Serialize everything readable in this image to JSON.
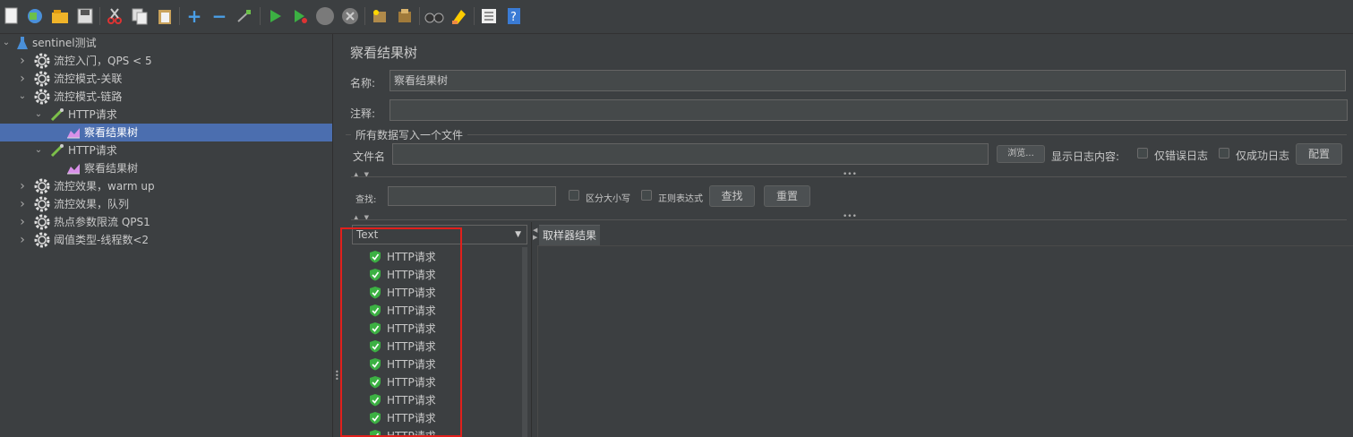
{
  "toolbar": {
    "icons": [
      "new-icon",
      "templates-icon",
      "open-icon",
      "save-icon",
      "cut-icon",
      "copy-icon",
      "paste-icon",
      "expand-icon",
      "collapse-icon",
      "toggle-icon",
      "start-icon",
      "start-no-pause-icon",
      "stop-icon",
      "shutdown-icon",
      "clear-icon",
      "clear-all-icon",
      "search-icon",
      "reset-search-icon",
      "function-helper-icon",
      "help-icon"
    ]
  },
  "tree": {
    "items": [
      {
        "label": "sentinel测试",
        "level": 0,
        "expanded": true,
        "icon": "flask-icon"
      },
      {
        "label": "流控入门，QPS < 5",
        "level": 1,
        "expanded": false,
        "icon": "gear-icon"
      },
      {
        "label": "流控模式-关联",
        "level": 1,
        "expanded": false,
        "icon": "gear-icon"
      },
      {
        "label": "流控模式-链路",
        "level": 1,
        "expanded": true,
        "icon": "gear-icon"
      },
      {
        "label": "HTTP请求",
        "level": 2,
        "expanded": true,
        "icon": "pipette-icon"
      },
      {
        "label": "察看结果树",
        "level": 3,
        "expanded": null,
        "icon": "chart-icon",
        "selected": true
      },
      {
        "label": "HTTP请求",
        "level": 2,
        "expanded": true,
        "icon": "pipette-icon"
      },
      {
        "label": "察看结果树",
        "level": 3,
        "expanded": null,
        "icon": "chart-icon"
      },
      {
        "label": "流控效果，warm up",
        "level": 1,
        "expanded": false,
        "icon": "gear-icon"
      },
      {
        "label": "流控效果，队列",
        "level": 1,
        "expanded": false,
        "icon": "gear-icon"
      },
      {
        "label": "热点参数限流 QPS1",
        "level": 1,
        "expanded": false,
        "icon": "gear-icon"
      },
      {
        "label": "阈值类型-线程数<2",
        "level": 1,
        "expanded": false,
        "icon": "gear-icon"
      }
    ]
  },
  "panel": {
    "title": "察看结果树",
    "name_label": "名称:",
    "name_value": "察看结果树",
    "comment_label": "注释:",
    "comment_value": "",
    "file_section_title": "所有数据写入一个文件",
    "filename_label": "文件名",
    "filename_value": "",
    "browse_label": "浏览...",
    "log_content_label": "显示日志内容:",
    "errors_only_label": "仅错误日志",
    "success_only_label": "仅成功日志",
    "configure_label": "配置",
    "search_label": "查找:",
    "search_value": "",
    "case_sensitive_label": "区分大小写",
    "regex_label": "正则表达式",
    "find_label": "查找",
    "reset_label": "重置",
    "renderer_value": "Text",
    "results_tab_label": "取样器结果",
    "results": [
      "HTTP请求",
      "HTTP请求",
      "HTTP请求",
      "HTTP请求",
      "HTTP请求",
      "HTTP请求",
      "HTTP请求",
      "HTTP请求",
      "HTTP请求",
      "HTTP请求",
      "HTTP请求"
    ]
  },
  "colors": {
    "highlight": "#e0201c",
    "selection": "#4b6eaf",
    "success": "#3cb043"
  }
}
